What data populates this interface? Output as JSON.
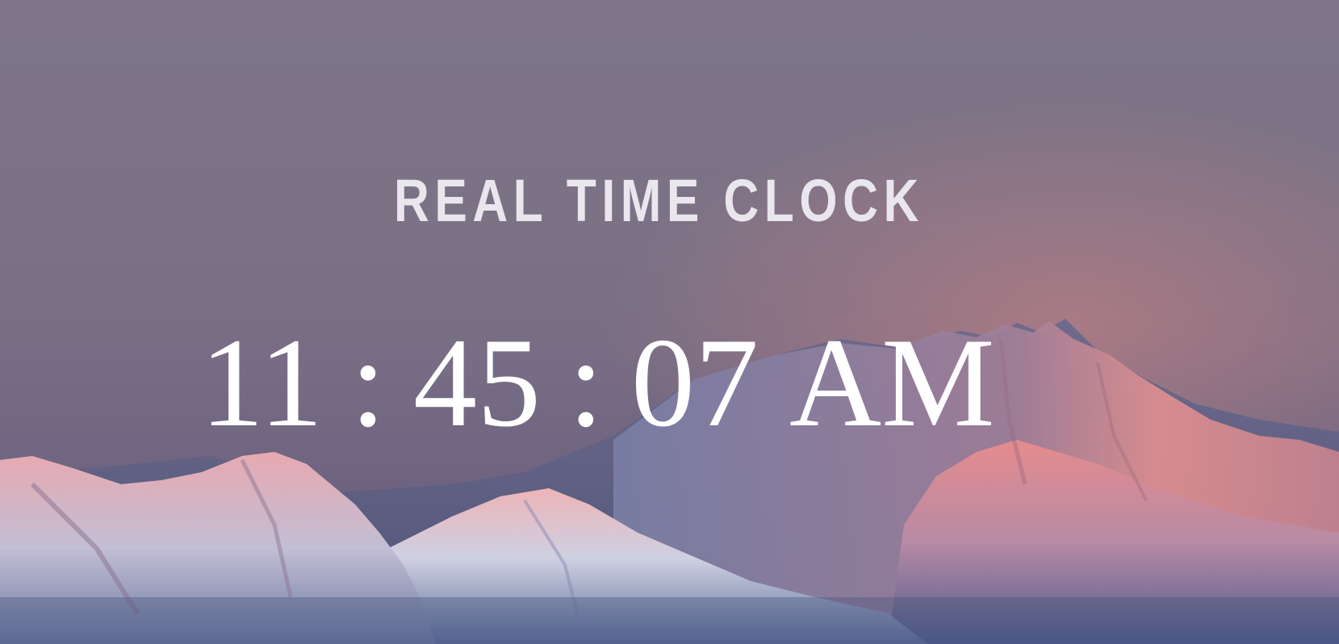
{
  "title": "REAL TIME CLOCK",
  "clock": {
    "hours": "11",
    "separator": ":",
    "minutes": "45",
    "seconds": "07",
    "period": "AM"
  },
  "colors": {
    "sky": "#7d7487",
    "text": "#ffffff",
    "title": "#e9e6ee",
    "alpenglow": "#e88a8e"
  }
}
